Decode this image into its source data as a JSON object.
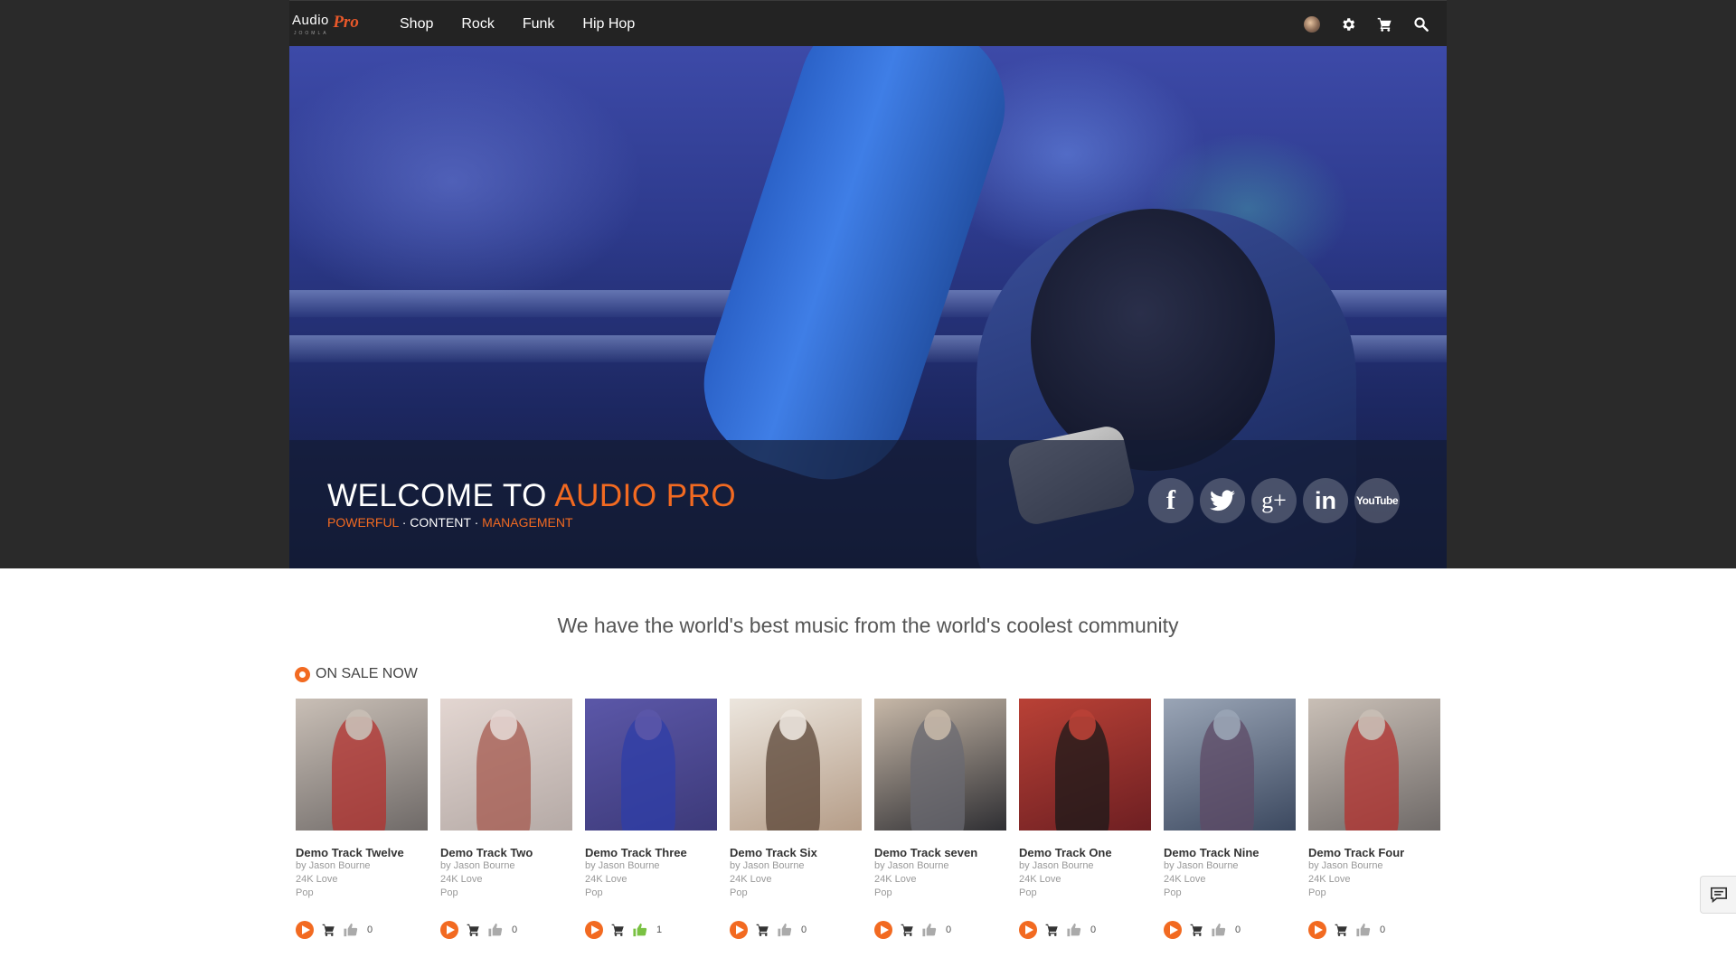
{
  "brand": {
    "logo_word1": "Audio",
    "logo_word2": "Pro",
    "logo_sub": "JOOMLA",
    "accent_color": "#f26a21"
  },
  "nav": {
    "links": [
      "Shop",
      "Rock",
      "Funk",
      "Hip Hop"
    ],
    "icons": [
      "user-avatar-icon",
      "gear-icon",
      "cart-icon",
      "search-icon"
    ]
  },
  "hero": {
    "welcome_prefix": "WELCOME TO",
    "welcome_accent": "AUDIO PRO",
    "tag_1": "POWERFUL",
    "tag_sep": "·",
    "tag_2": "CONTENT",
    "tag_3": "MANAGEMENT",
    "socials": [
      {
        "name": "facebook-icon",
        "glyph": "f"
      },
      {
        "name": "twitter-icon",
        "glyph": ""
      },
      {
        "name": "google-plus-icon",
        "glyph": "g+"
      },
      {
        "name": "linkedin-icon",
        "glyph": "in"
      },
      {
        "name": "youtube-icon",
        "glyph": "YouTube"
      }
    ]
  },
  "main": {
    "headline": "We have the world's best music from the world's coolest community",
    "section_title": "ON SALE NOW",
    "tracks": [
      {
        "title": "Demo Track Twelve",
        "artist": "by Jason Bourne",
        "album": "24K Love",
        "genre": "Pop",
        "likes": "0",
        "liked": false
      },
      {
        "title": "Demo Track Two",
        "artist": "by Jason Bourne",
        "album": "24K Love",
        "genre": "Pop",
        "likes": "0",
        "liked": false
      },
      {
        "title": "Demo Track Three",
        "artist": "by Jason Bourne",
        "album": "24K Love",
        "genre": "Pop",
        "likes": "1",
        "liked": true
      },
      {
        "title": "Demo Track Six",
        "artist": "by Jason Bourne",
        "album": "24K Love",
        "genre": "Pop",
        "likes": "0",
        "liked": false
      },
      {
        "title": "Demo Track seven",
        "artist": "by Jason Bourne",
        "album": "24K Love",
        "genre": "Pop",
        "likes": "0",
        "liked": false
      },
      {
        "title": "Demo Track One",
        "artist": "by Jason Bourne",
        "album": "24K Love",
        "genre": "Pop",
        "likes": "0",
        "liked": false
      },
      {
        "title": "Demo Track Nine",
        "artist": "by Jason Bourne",
        "album": "24K Love",
        "genre": "Pop",
        "likes": "0",
        "liked": false
      },
      {
        "title": "Demo Track Four",
        "artist": "by Jason Bourne",
        "album": "24K Love",
        "genre": "Pop",
        "likes": "0",
        "liked": false
      }
    ]
  },
  "thumb_palettes": [
    [
      "#6f6a68",
      "#c9bfb6",
      "#b3302e"
    ],
    [
      "#b5aaa6",
      "#e3d6d1",
      "#a55a4f"
    ],
    [
      "#3d3a7a",
      "#5b57a8",
      "#2d3ea8"
    ],
    [
      "#b59d88",
      "#ece6de",
      "#5a4436"
    ],
    [
      "#2f2f33",
      "#c7b8a8",
      "#6a6a72"
    ],
    [
      "#6e1f22",
      "#b94136",
      "#1a1a1a"
    ],
    [
      "#3c4960",
      "#9aa5b6",
      "#5e4a66"
    ],
    [
      "#6f6a68",
      "#c9bfb6",
      "#b3302e"
    ]
  ]
}
